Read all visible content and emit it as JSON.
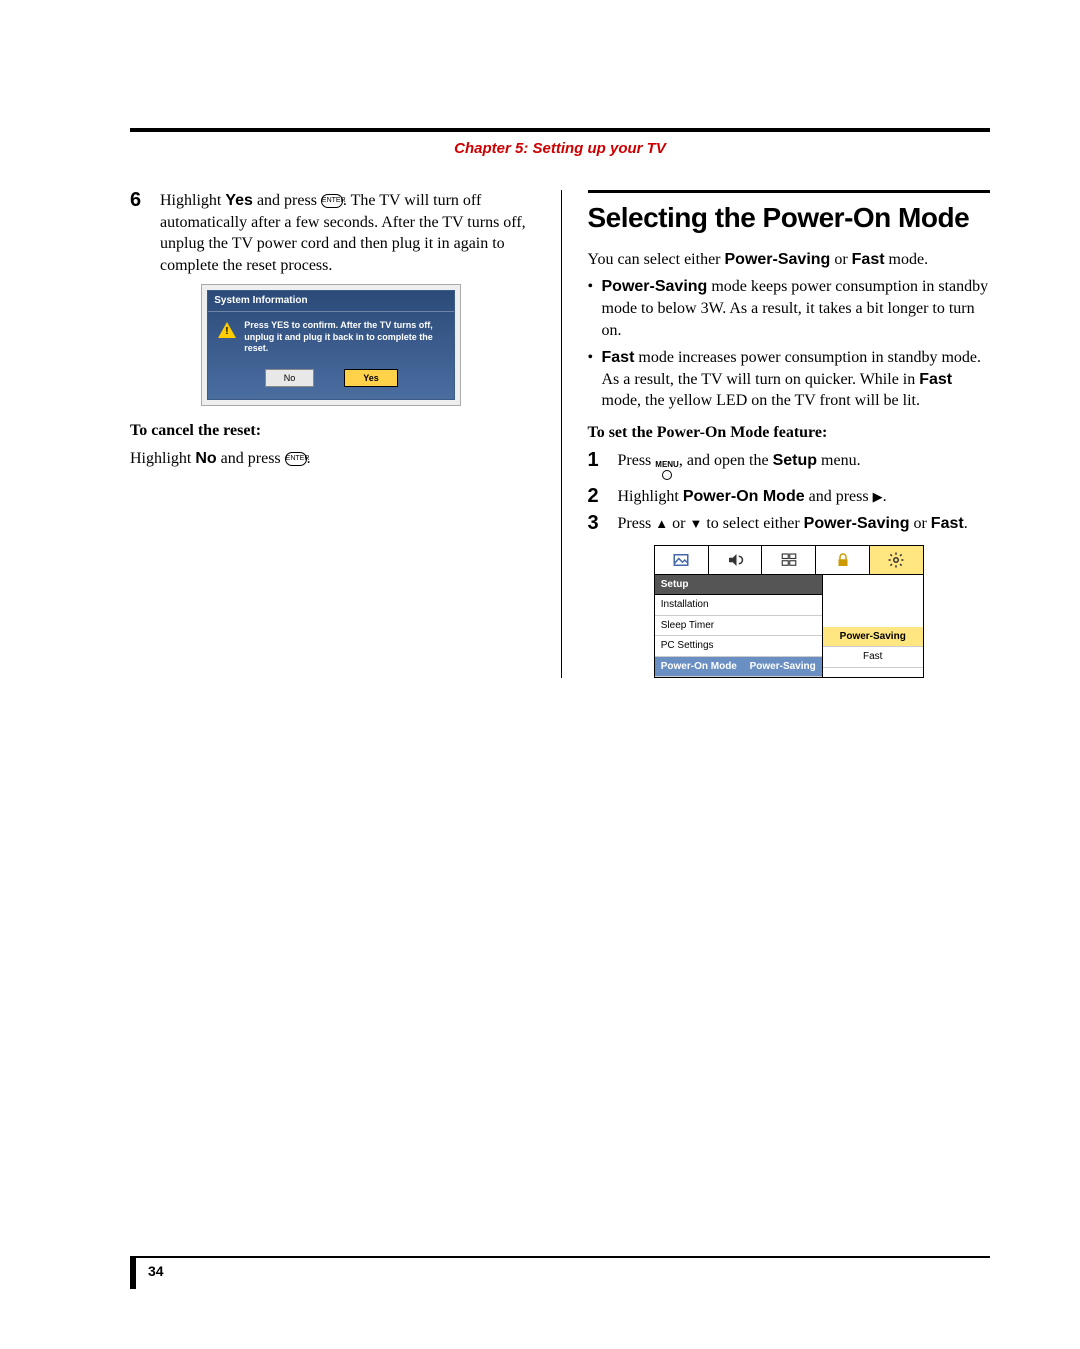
{
  "chapter": {
    "title": "Chapter 5: Setting up your TV"
  },
  "left": {
    "step6": {
      "num": "6",
      "part1": "Highlight ",
      "yes": "Yes",
      "part2": " and press ",
      "enter_icon": "ENTER",
      "part3": ". The TV will turn off automatically after a few seconds. After the TV turns off, unplug the TV power cord and then plug it in again to complete the reset process."
    },
    "dialog": {
      "title": "System Information",
      "message": "Press YES to confirm. After the TV turns off, unplug it and plug it back in to complete the reset.",
      "btn_no": "No",
      "btn_yes": "Yes"
    },
    "cancel_heading": "To cancel the reset:",
    "cancel_part1": "Highlight ",
    "cancel_no": "No",
    "cancel_part2": " and press ",
    "cancel_enter": "ENTER",
    "cancel_part3": "."
  },
  "right": {
    "heading": "Selecting the Power-On Mode",
    "intro_a": "You can select either ",
    "intro_ps": "Power-Saving",
    "intro_b": " or ",
    "intro_fast": "Fast",
    "intro_c": " mode.",
    "bullet1": {
      "b": "Power-Saving",
      "t": " mode keeps power consumption in standby mode to below 3W. As a result, it takes a bit longer to turn on."
    },
    "bullet2": {
      "b": "Fast",
      "t1": " mode increases power consumption in standby mode. As a result, the TV will turn on quicker. While in ",
      "b2": "Fast",
      "t2": " mode, the yellow LED on the TV front will be lit."
    },
    "subhead": "To set the Power-On Mode feature:",
    "s1": {
      "n": "1",
      "a": "Press ",
      "menu_label": "MENU",
      "b": ", and open the ",
      "setup": "Setup",
      "c": " menu."
    },
    "s2": {
      "n": "2",
      "a": "Highlight ",
      "pom": "Power-On Mode",
      "b": " and press ",
      "tri": "▶",
      "c": "."
    },
    "s3": {
      "n": "3",
      "a": "Press ",
      "up": "▲",
      "b": " or ",
      "dn": "▼",
      "c": " to select either ",
      "ps": "Power-Saving",
      "d": " or ",
      "fast": "Fast",
      "e": "."
    },
    "menu": {
      "section": "Setup",
      "rows": {
        "r0": "Installation",
        "r1": "Sleep Timer",
        "r2": "PC Settings",
        "r3_label": "Power-On Mode",
        "r3_value": "Power-Saving"
      },
      "opts": {
        "o0": "Power-Saving",
        "o1": "Fast"
      }
    }
  },
  "page_number": "34"
}
